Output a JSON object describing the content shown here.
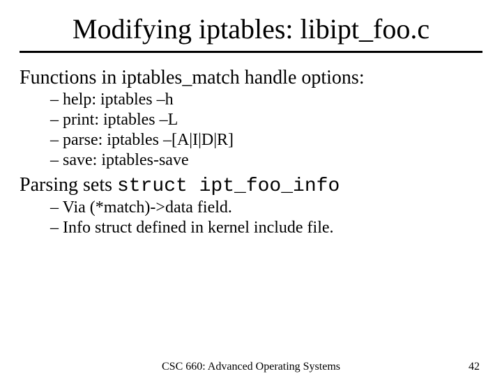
{
  "title": "Modifying iptables: libipt_foo.c",
  "line1": "Functions in iptables_match handle options:",
  "b1": "help: iptables –h",
  "b2": "print: iptables –L",
  "b3": "parse: iptables –[A|I|D|R]",
  "b4": "save: iptables-save",
  "line2a": "Parsing sets ",
  "line2b": "struct ipt_foo_info",
  "c1": "Via (*match)->data field.",
  "c2": "Info struct defined in kernel include file.",
  "footer_center": "CSC 660: Advanced Operating Systems",
  "footer_right": "42"
}
